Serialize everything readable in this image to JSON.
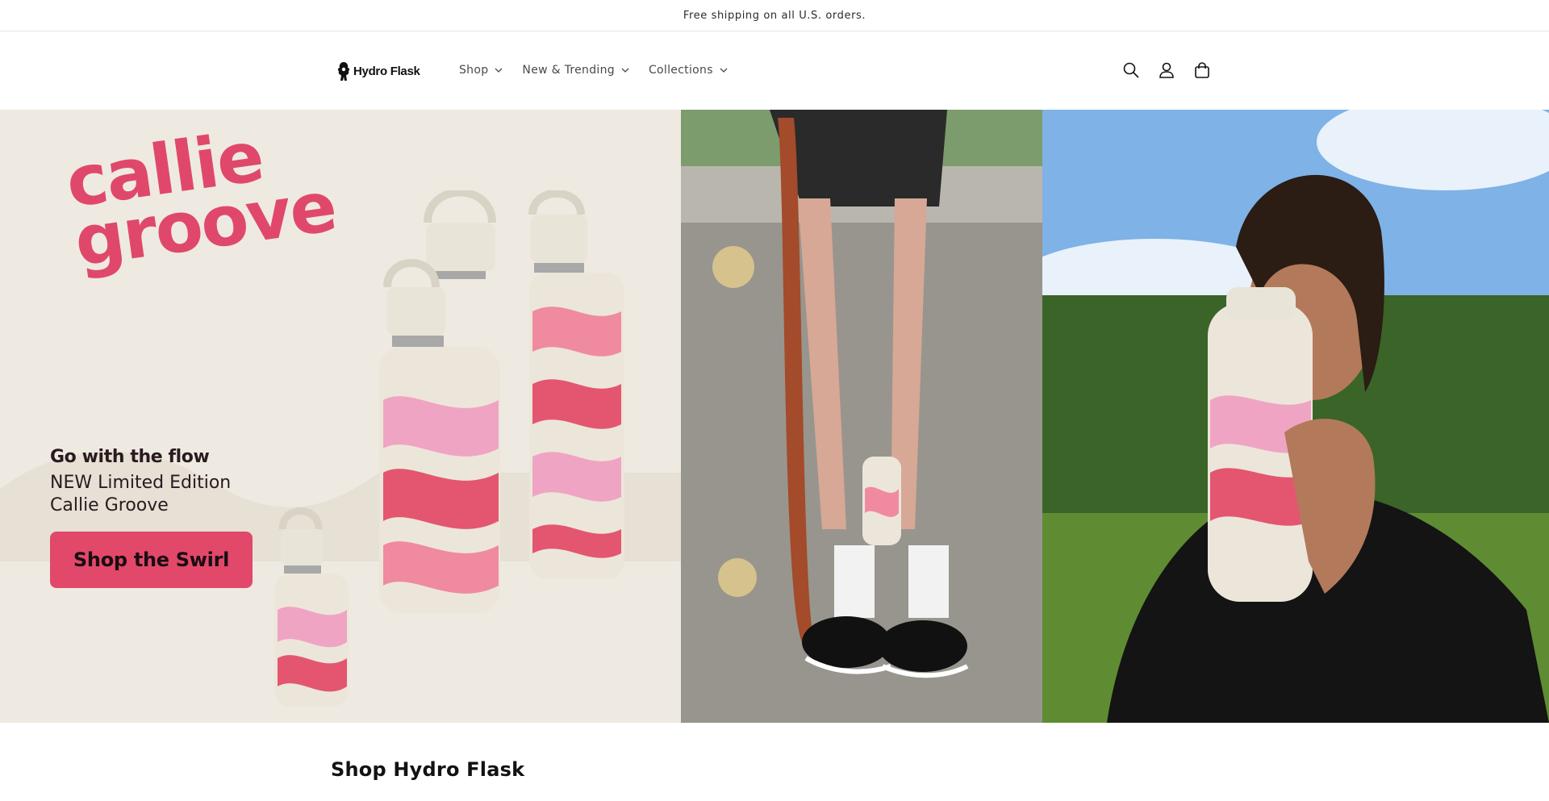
{
  "announcement": {
    "text": "Free shipping on all U.S. orders."
  },
  "header": {
    "logo_text": "Hydro Flask",
    "nav": [
      {
        "label": "Shop"
      },
      {
        "label": "New & Trending"
      },
      {
        "label": "Collections"
      }
    ],
    "icons": [
      "search-icon",
      "account-icon",
      "cart-icon"
    ]
  },
  "hero": {
    "headline_line1": "callie",
    "headline_line2": "groove",
    "promo_title": "Go with the flow",
    "promo_sub_line1": "NEW Limited Edition",
    "promo_sub_line2": "Callie Groove",
    "cta_label": "Shop the Swirl",
    "colors": {
      "brand_pink": "#e0486b",
      "panel_bg": "#efeae1"
    }
  },
  "section": {
    "title": "Shop Hydro Flask"
  }
}
